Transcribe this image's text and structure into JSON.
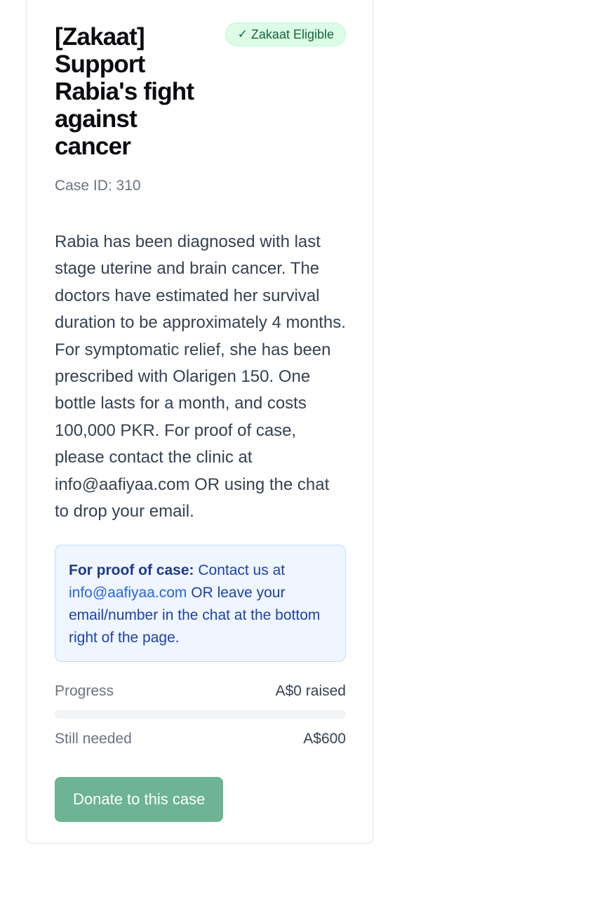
{
  "case": {
    "title": "[Zakaat] Support Rabia's fight against cancer",
    "badge": {
      "icon": "check-icon",
      "check": "✓",
      "label": "Zakaat Eligible",
      "color": "#166534"
    },
    "case_id": "Case ID: 310",
    "description": "Rabia has been diagnosed with last stage uterine and brain cancer. The doctors have estimated her survival duration to be approximately 4 months. For symptomatic relief, she has been prescribed with Olarigen 150. One bottle lasts for a month, and costs 100,000 PKR. For proof of case, please contact the clinic at info@aafiyaa.com OR using the chat to drop your email.",
    "proof_notice": {
      "label": "For proof of case:",
      "text_before": " Contact us at ",
      "email": "info@aafiyaa.com",
      "text_after": " OR leave your email/number in the chat at the bottom right of the page."
    },
    "progress": {
      "label": "Progress",
      "raised": "A$0 raised",
      "fraction": 0
    },
    "needed": {
      "label": "Still needed",
      "amount": "A$600"
    },
    "donate_label": "Donate to this case"
  },
  "colors": {
    "donate_button": "#6cb493",
    "badge_bg": "#dcfce7",
    "notice_bg": "#eff6ff",
    "link": "#2563eb"
  }
}
